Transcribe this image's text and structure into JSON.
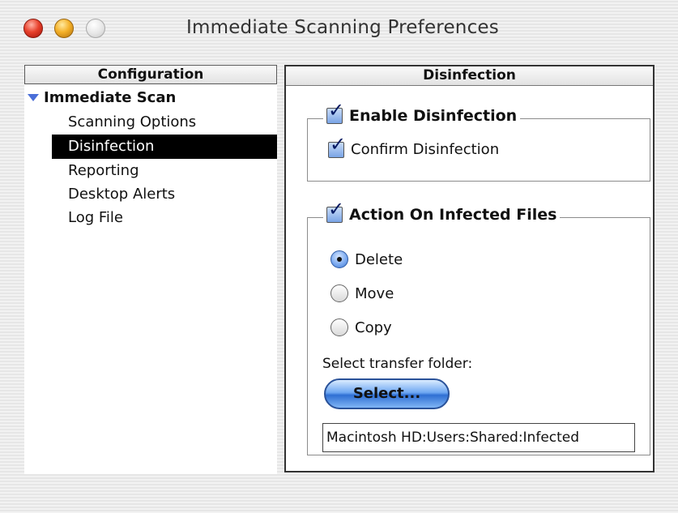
{
  "window": {
    "title": "Immediate Scanning Preferences"
  },
  "left_panel": {
    "header": "Configuration",
    "root_label": "Immediate Scan",
    "items": [
      {
        "label": "Scanning Options"
      },
      {
        "label": "Disinfection"
      },
      {
        "label": "Reporting"
      },
      {
        "label": "Desktop Alerts"
      },
      {
        "label": "Log File"
      }
    ],
    "selected_item": "Disinfection"
  },
  "right_panel": {
    "header": "Disinfection",
    "enable_disinfection": {
      "label": "Enable Disinfection",
      "checked": true
    },
    "confirm_disinfection": {
      "label": "Confirm Disinfection",
      "checked": true
    },
    "action_on_infected": {
      "label": "Action On Infected Files",
      "checked": true
    },
    "radios": [
      {
        "label": "Delete",
        "selected": true
      },
      {
        "label": "Move",
        "selected": false
      },
      {
        "label": "Copy",
        "selected": false
      }
    ],
    "transfer_label": "Select transfer folder:",
    "select_button": "Select...",
    "folder_path": "Macintosh HD:Users:Shared:Infected"
  },
  "colors": {
    "selection_background": "#000000",
    "accent_blue": "#4a7fe0"
  }
}
